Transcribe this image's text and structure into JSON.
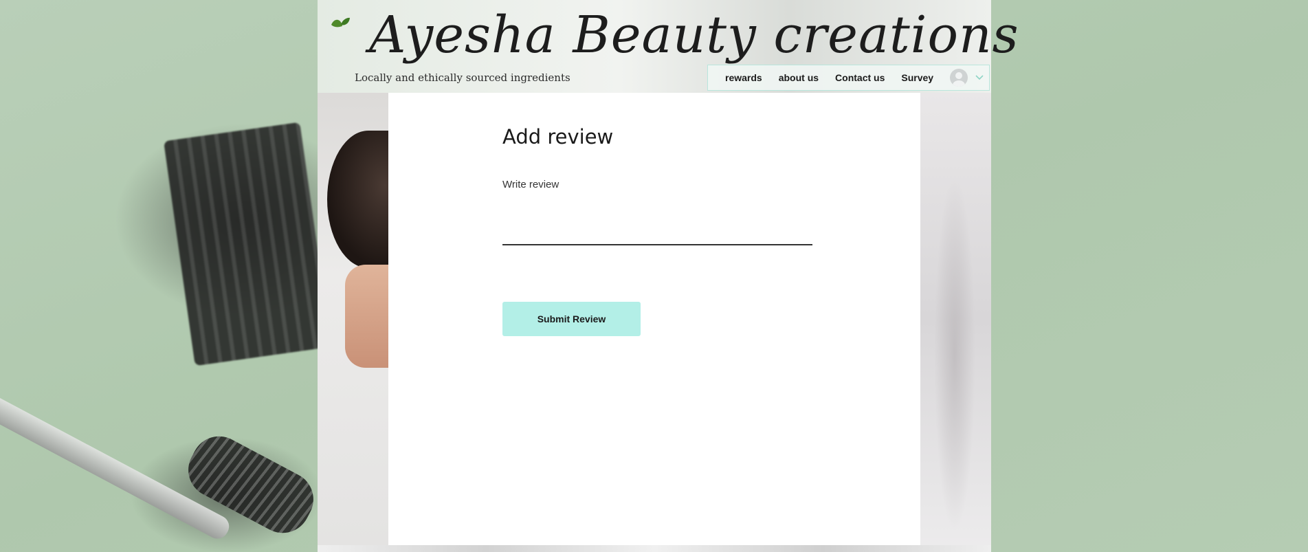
{
  "site": {
    "title": "Ayesha Beauty creations",
    "tagline": "Locally and ethically sourced ingredients"
  },
  "nav": {
    "items": [
      "rewards",
      "about us",
      "Contact us",
      "Survey"
    ]
  },
  "review": {
    "heading": "Add review",
    "label": "Write review",
    "value": "",
    "submit_label": "Submit Review"
  },
  "colors": {
    "accent": "#b3efe7",
    "nav_border": "#b9e6dc",
    "background": "#b7cdb5",
    "leaf": "#4f8a2a"
  },
  "icons": {
    "logo": "leaf-icon",
    "account": "user-avatar-icon",
    "dropdown": "chevron-down-icon"
  }
}
